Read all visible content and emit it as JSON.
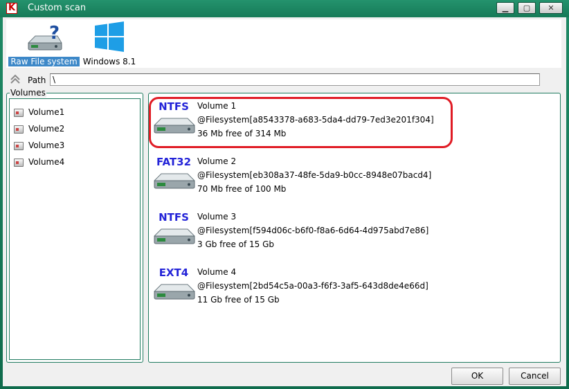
{
  "window": {
    "title": "Custom scan",
    "app_icon_letter": "K",
    "controls": {
      "minimize": "▁",
      "maximize": "▢",
      "close": "✕"
    }
  },
  "sources": [
    {
      "label": "Raw File system",
      "icon": "drive-question-icon",
      "selected": true
    },
    {
      "label": "Windows 8.1",
      "icon": "windows-logo-icon",
      "selected": false
    }
  ],
  "path": {
    "label": "Path",
    "value": "\\"
  },
  "volumes_panel": {
    "title": "Volumes",
    "items": [
      "Volume1",
      "Volume2",
      "Volume3",
      "Volume4"
    ]
  },
  "volume_entries": [
    {
      "fs": "NTFS",
      "name": "Volume 1",
      "id": "@Filesystem[a8543378-a683-5da4-dd79-7ed3e201f304]",
      "free": "36 Mb free of 314 Mb"
    },
    {
      "fs": "FAT32",
      "name": "Volume 2",
      "id": "@Filesystem[eb308a37-48fe-5da9-b0cc-8948e07bacd4]",
      "free": "70 Mb free of 100 Mb"
    },
    {
      "fs": "NTFS",
      "name": "Volume 3",
      "id": "@Filesystem[f594d06c-b6f0-f8a6-6d64-4d975abd7e86]",
      "free": "3 Gb free of 15 Gb"
    },
    {
      "fs": "EXT4",
      "name": "Volume 4",
      "id": "@Filesystem[2bd54c5a-00a3-f6f3-3af5-643d8de4e66d]",
      "free": "11 Gb free of 15 Gb"
    }
  ],
  "buttons": {
    "ok": "OK",
    "cancel": "Cancel"
  },
  "colors": {
    "accent": "#1e7a5e",
    "selection": "#3d88c8",
    "fs_label": "#2424d8",
    "highlight": "#e01b24"
  }
}
